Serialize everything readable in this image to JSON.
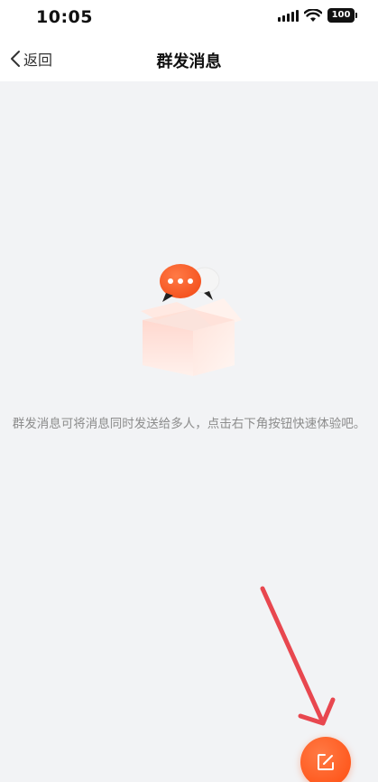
{
  "status_bar": {
    "time": "10:05",
    "battery": "100",
    "icons": [
      "signal-icon",
      "wifi-icon",
      "battery-icon"
    ]
  },
  "nav": {
    "back_label": "返回",
    "title": "群发消息"
  },
  "empty_state": {
    "description": "群发消息可将消息同时发送给多人，点击右下角按钮快速体验吧。",
    "illustration": "chat-box-illustration"
  },
  "fab": {
    "icon": "edit-icon"
  },
  "colors": {
    "accent": "#ff5a1f",
    "annotation": "#e8474f",
    "background": "#f2f3f5"
  }
}
